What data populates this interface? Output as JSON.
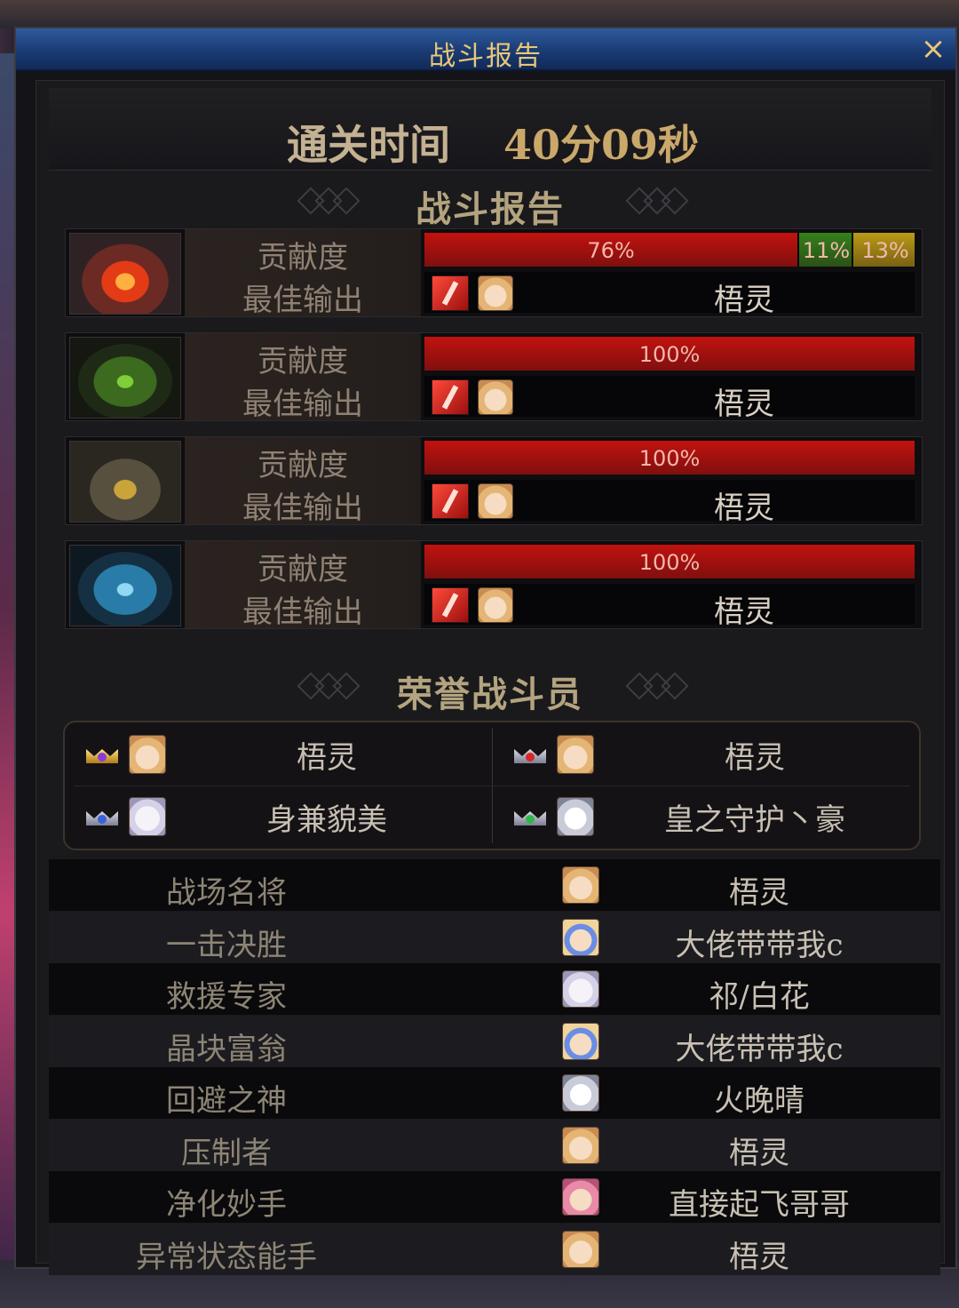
{
  "window": {
    "title": "战斗报告",
    "close_icon": "×"
  },
  "clear_time": {
    "label": "通关时间",
    "value": "40分09秒"
  },
  "battle_report_heading": "战斗报告",
  "bosses": [
    {
      "portrait_icon": "boss-fire-emblem-icon",
      "contribution_label": "贡献度",
      "best_damage_label": "最佳输出",
      "contribution": [
        {
          "percent": 76,
          "text": "76%",
          "color": "#c2120f"
        },
        {
          "percent": 11,
          "text": "11%",
          "color": "#35801b"
        },
        {
          "percent": 13,
          "text": "13%",
          "color": "#b99a16"
        }
      ],
      "best_player": "梧灵"
    },
    {
      "portrait_icon": "boss-green-emblem-icon",
      "contribution_label": "贡献度",
      "best_damage_label": "最佳输出",
      "contribution": [
        {
          "percent": 100,
          "text": "100%",
          "color": "#c2120f"
        }
      ],
      "best_player": "梧灵"
    },
    {
      "portrait_icon": "boss-gold-emblem-icon",
      "contribution_label": "贡献度",
      "best_damage_label": "最佳输出",
      "contribution": [
        {
          "percent": 100,
          "text": "100%",
          "color": "#c2120f"
        }
      ],
      "best_player": "梧灵"
    },
    {
      "portrait_icon": "boss-ice-emblem-icon",
      "contribution_label": "贡献度",
      "best_damage_label": "最佳输出",
      "contribution": [
        {
          "percent": 100,
          "text": "100%",
          "color": "#c2120f"
        }
      ],
      "best_player": "梧灵"
    }
  ],
  "honor_heading": "荣誉战斗员",
  "honor_members": [
    {
      "name": "梧灵",
      "crown": "gold",
      "gem_color": "#8a3cd8",
      "avatar": "blonde"
    },
    {
      "name": "梧灵",
      "crown": "silver",
      "gem_color": "#d8262a",
      "avatar": "blonde"
    },
    {
      "name": "身兼貌美",
      "crown": "silver",
      "gem_color": "#3a62d8",
      "avatar": "white"
    },
    {
      "name": "皇之守护丶豪",
      "crown": "silver",
      "gem_color": "#2fb84a",
      "avatar": "silver"
    }
  ],
  "awards": [
    {
      "title": "战场名将",
      "player": "梧灵",
      "avatar": "blonde"
    },
    {
      "title": "一击决胜",
      "player": "大佬带带我c",
      "avatar": "blue"
    },
    {
      "title": "救援专家",
      "player": "祁/白花",
      "avatar": "white"
    },
    {
      "title": "晶块富翁",
      "player": "大佬带带我c",
      "avatar": "blue"
    },
    {
      "title": "回避之神",
      "player": "火晚晴",
      "avatar": "silver"
    },
    {
      "title": "压制者",
      "player": "梧灵",
      "avatar": "blonde"
    },
    {
      "title": "净化妙手",
      "player": "直接起飞哥哥",
      "avatar": "pink"
    },
    {
      "title": "异常状态能手",
      "player": "梧灵",
      "avatar": "blonde"
    }
  ]
}
